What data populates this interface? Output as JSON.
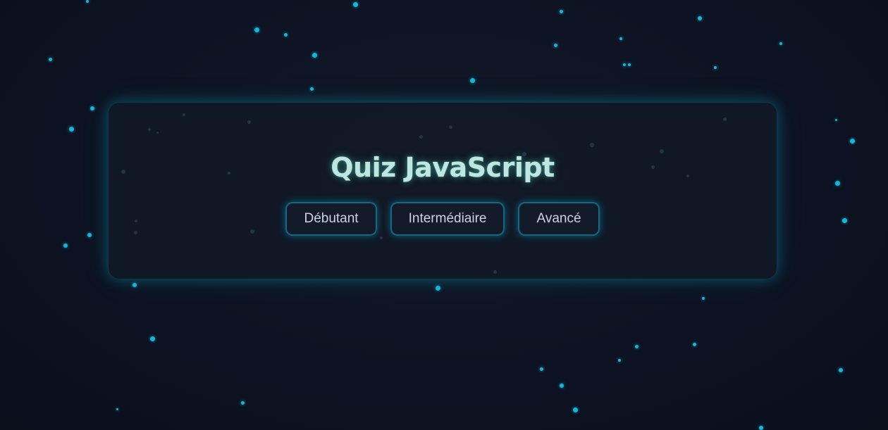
{
  "quiz": {
    "title": "Quiz JavaScript",
    "levels": [
      {
        "label": "Débutant"
      },
      {
        "label": "Intermédiaire"
      },
      {
        "label": "Avancé"
      }
    ]
  },
  "colors": {
    "background": "#0d1322",
    "card": "#111826",
    "accent_glow": "#00bed7",
    "star": "#12b8dc",
    "title": "#bfe6e0",
    "button_text": "#c9d3e2"
  }
}
